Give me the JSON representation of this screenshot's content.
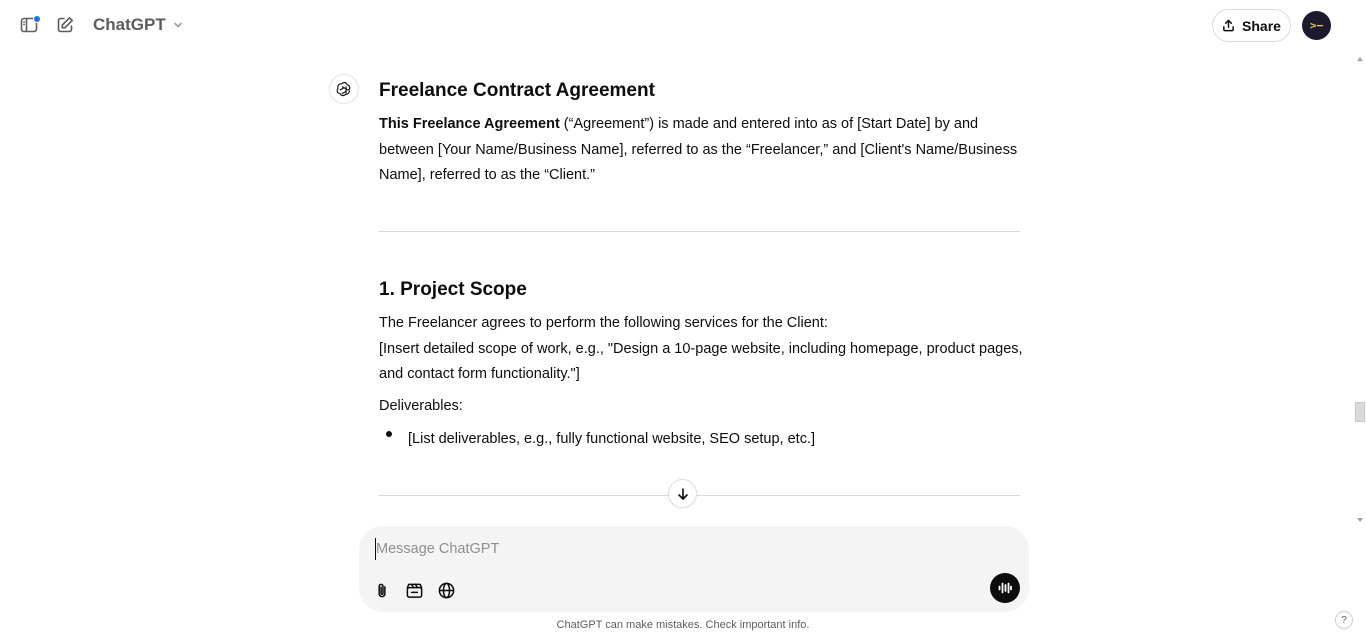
{
  "header": {
    "model_name": "ChatGPT",
    "share_label": "Share",
    "avatar_initials": ">−"
  },
  "message": {
    "title": "Freelance Contract Agreement",
    "intro_bold": "This Freelance Agreement",
    "intro_line1_rest": " (“Agreement”) is made and entered into as of [Start Date] by and",
    "intro_line2": "between [Your Name/Business Name], referred to as the “Freelancer,” and [Client's Name/Business",
    "intro_line3": "Name], referred to as the “Client.”",
    "section1_heading": "1. Project Scope",
    "section1_line1": "The Freelancer agrees to perform the following services for the Client:",
    "section1_line2": "[Insert detailed scope of work, e.g., \"Design a 10-page website, including homepage, product pages,",
    "section1_line3": "and contact form functionality.\"]",
    "deliverables_label": "Deliverables:",
    "deliverables_items": [
      "[List deliverables, e.g., fully functional website, SEO setup, etc.]"
    ]
  },
  "composer": {
    "placeholder": "Message ChatGPT"
  },
  "footer": {
    "disclaimer": "ChatGPT can make mistakes. Check important info.",
    "help_label": "?"
  },
  "colors": {
    "notification_dot": "#1a73e8",
    "avatar_bg": "#1d1a30",
    "avatar_fg": "#f2c84b",
    "composer_bg": "#f4f4f4"
  },
  "icons": {
    "sidebar_toggle": "sidebar-icon",
    "new_chat": "new-chat-icon",
    "model_chevron": "chevron-down-icon",
    "share": "upload-icon",
    "assistant": "openai-logo-icon",
    "scroll_down": "arrow-down-icon",
    "attach": "paperclip-icon",
    "tools": "toolbox-icon",
    "search": "globe-icon",
    "voice": "voice-wave-icon"
  }
}
